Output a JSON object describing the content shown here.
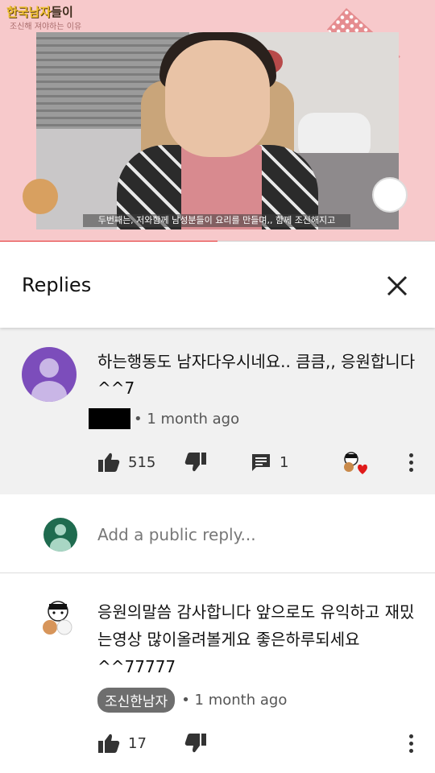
{
  "video": {
    "channel_title_main": "한국남자",
    "channel_title_rest": "들이",
    "channel_subtitle": "조신해 져야하는 이유",
    "caption": "두번째는, 저와함께 남성분들이 요리를 만들며,, 함께 조신해지고",
    "progress": 0.5
  },
  "replies_panel": {
    "title": "Replies"
  },
  "main_comment": {
    "text": "하는행동도 남자다우시네요.. 큼큼,, 응원합니다^^7",
    "time": "• 1 month ago",
    "likes": "515",
    "reply_count": "1"
  },
  "reply_box": {
    "placeholder": "Add a public reply..."
  },
  "reply": {
    "text": "응원의말씀 감사합니다 앞으로도 유익하고 재밌는영상 많이올려볼게요 좋은하루되세요 ^^77777",
    "author": "조신한남자",
    "time": "• 1 month ago",
    "likes": "17"
  },
  "colors": {
    "video_bg": "#f7c9cb",
    "progress": "#e22b2b",
    "comment_bg": "#f1f1f1",
    "avatar_purple": "#7c4dbb",
    "avatar_green": "#1f6b4f",
    "owner_badge": "#6e6e6e"
  }
}
